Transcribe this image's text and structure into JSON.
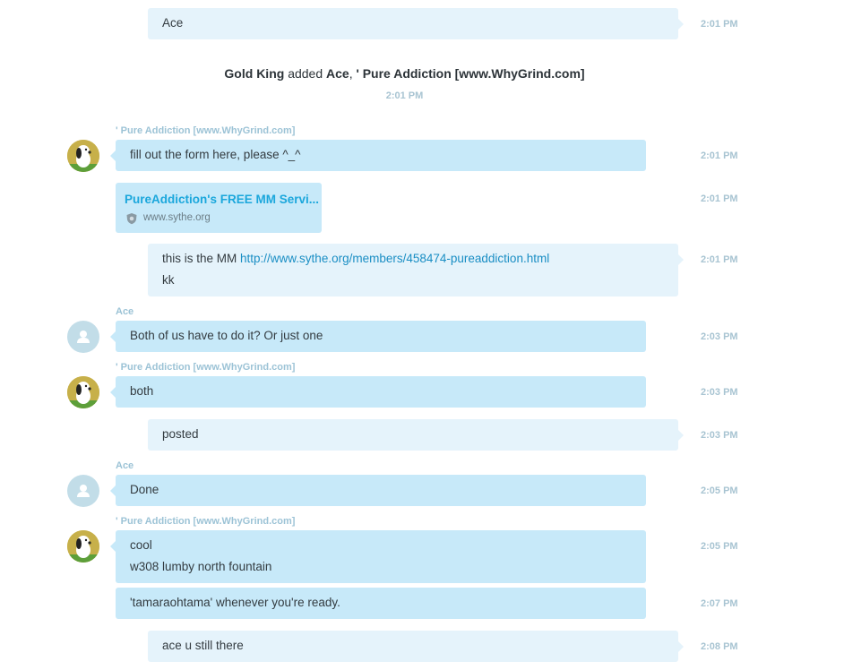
{
  "colors": {
    "outgoing_bubble": "#e5f3fb",
    "incoming_bubble": "#c7e9f9",
    "sender_name": "#9cc3d6",
    "timestamp": "#a8c4d2",
    "link": "#1a8ec4",
    "card_title": "#1ba7dc"
  },
  "messages": {
    "m1": {
      "text": "Ace",
      "time": "2:01 PM"
    },
    "system": {
      "actor": "Gold King",
      "verb": " added ",
      "target1": "Ace",
      "sep": ", ",
      "target2": "' Pure Addiction [www.WhyGrind.com]",
      "time": "2:01 PM"
    },
    "m2": {
      "sender": "' Pure Addiction [www.WhyGrind.com]",
      "text": "fill out the form here, please ^_^",
      "time": "2:01 PM",
      "avatar": "snoopy-avatar"
    },
    "m3": {
      "card_title": "PureAddiction's FREE MM Servi...",
      "card_domain": "www.sythe.org",
      "time": "2:01 PM",
      "icon": "shield-icon"
    },
    "m4": {
      "prefix": "this is the MM ",
      "link": "http://www.sythe.org/members/458474-pureaddiction.html",
      "line2": "kk",
      "time": "2:01 PM"
    },
    "m5": {
      "sender": "Ace",
      "text": "Both of us have to do it? Or just one",
      "time": "2:03 PM",
      "avatar": "default-user-avatar"
    },
    "m6": {
      "sender": "' Pure Addiction [www.WhyGrind.com]",
      "text": "both",
      "time": "2:03 PM",
      "avatar": "snoopy-avatar"
    },
    "m7": {
      "text": "posted",
      "time": "2:03 PM"
    },
    "m8": {
      "sender": "Ace",
      "text": "Done",
      "time": "2:05 PM",
      "avatar": "default-user-avatar"
    },
    "m9": {
      "sender": "' Pure Addiction [www.WhyGrind.com]",
      "line1": "cool",
      "line2": "w308 lumby north fountain",
      "time": "2:05 PM",
      "avatar": "snoopy-avatar"
    },
    "m10": {
      "text": "'tamaraohtama' whenever you're ready.",
      "time": "2:07 PM"
    },
    "m11": {
      "text": "ace u still there",
      "time": "2:08 PM"
    }
  }
}
